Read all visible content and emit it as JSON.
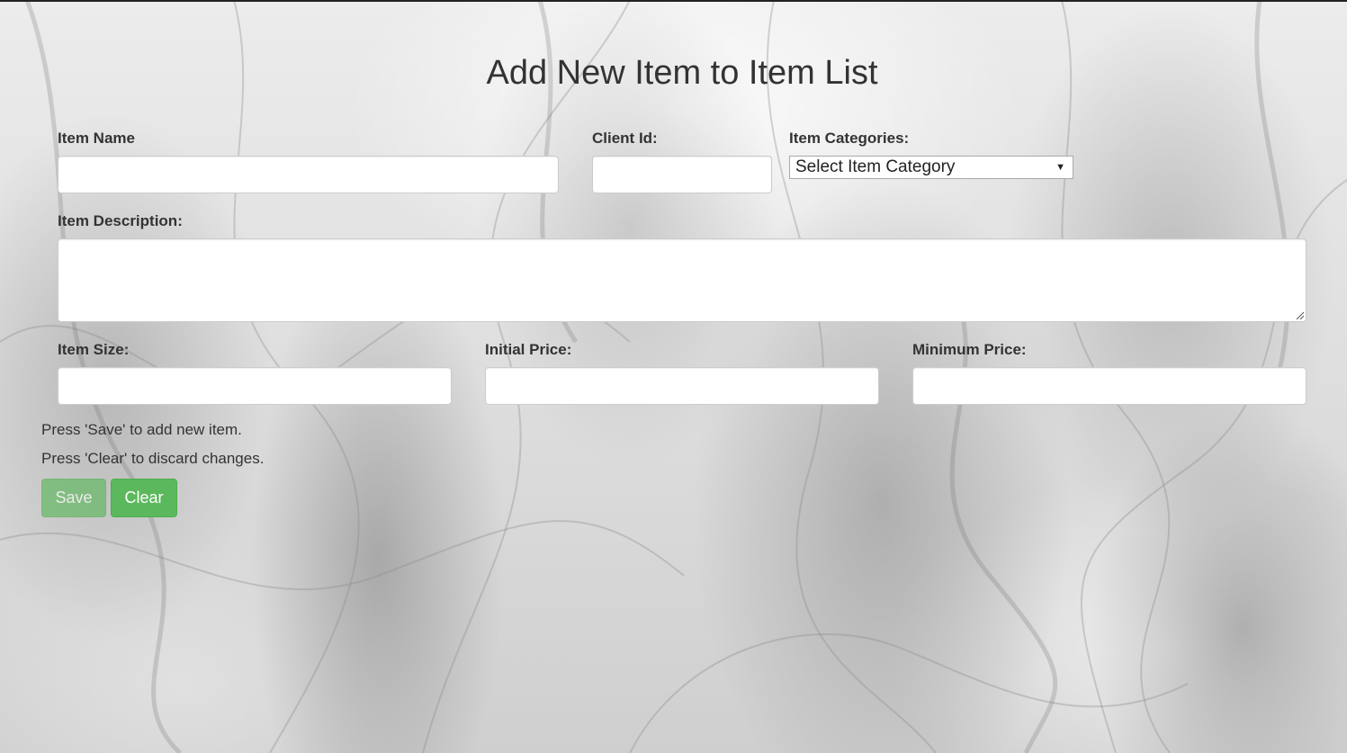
{
  "page": {
    "title": "Add New Item to Item List"
  },
  "form": {
    "item_name": {
      "label": "Item Name",
      "value": "",
      "placeholder": ""
    },
    "client_id": {
      "label": "Client Id:",
      "value": "",
      "placeholder": ""
    },
    "item_categories": {
      "label": "Item Categories:",
      "selected": "Select Item Category"
    },
    "item_description": {
      "label": "Item Description:",
      "value": "",
      "placeholder": ""
    },
    "item_size": {
      "label": "Item Size:",
      "value": "",
      "placeholder": ""
    },
    "initial_price": {
      "label": "Initial Price:",
      "value": "",
      "placeholder": ""
    },
    "minimum_price": {
      "label": "Minimum Price:",
      "value": "",
      "placeholder": ""
    }
  },
  "help": {
    "save_text": "Press 'Save' to add new item.",
    "clear_text": "Press 'Clear' to discard changes."
  },
  "buttons": {
    "save_label": "Save",
    "save_disabled": true,
    "clear_label": "Clear"
  },
  "colors": {
    "button_green": "#5cb85c",
    "text": "#333333"
  }
}
